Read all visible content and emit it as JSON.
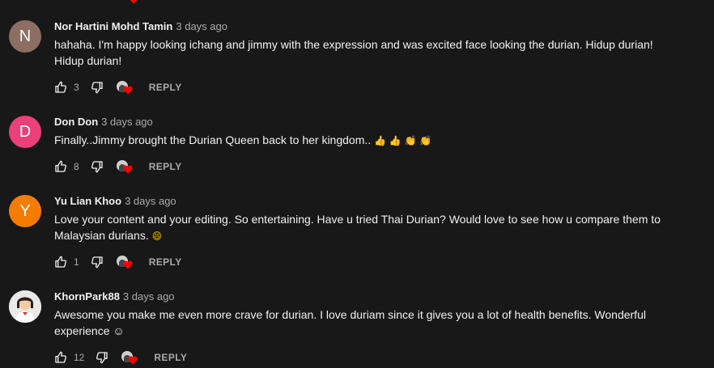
{
  "comments": [
    {
      "author": "Nor Hartini Mohd Tamin",
      "time": "3 days ago",
      "text": "hahaha. I'm happy looking  ichang and jimmy with the expression and was excited face looking the durian. Hidup durian! Hidup durian!",
      "likes": "3",
      "avatar_letter": "N",
      "avatar_color": "#8d6e63",
      "reply_label": "REPLY"
    },
    {
      "author": "Don Don",
      "time": "3 days ago",
      "text": "Finally..Jimmy brought the Durian Queen back to her kingdom..",
      "emojis": "👍 👍 👏 👏",
      "likes": "8",
      "avatar_letter": "D",
      "avatar_color": "#ec407a",
      "reply_label": "REPLY"
    },
    {
      "author": "Yu Lian Khoo",
      "time": "3 days ago",
      "text": "Love your content and your editing. So entertaining. Have u tried Thai Durian?  Would love to see how u compare them to Malaysian durians.",
      "emojis": "😄",
      "likes": "1",
      "avatar_letter": "Y",
      "avatar_color": "#f57c00",
      "reply_label": "REPLY"
    },
    {
      "author": "KhornPark88",
      "time": "3 days ago",
      "text": "Awesome you make me even more crave for durian. I love duriam since it gives you a lot of health benefits. Wonderful experience ☺",
      "likes": "12",
      "avatar_letter": "",
      "avatar_color": "#e8e8e8",
      "reply_label": "REPLY"
    }
  ],
  "colors": {
    "background": "#181818",
    "primary_text": "#f1f1f1",
    "secondary_text": "#aaaaaa",
    "heart": "#ff0000"
  },
  "icons": {
    "like": "thumbs-up-icon",
    "dislike": "thumbs-down-icon",
    "creator_heart": "creator-heart-icon"
  }
}
